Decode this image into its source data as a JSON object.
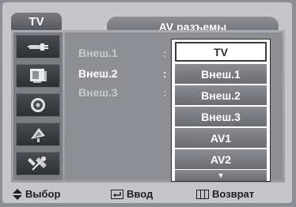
{
  "header": {
    "tab_label": "TV",
    "title": "AV разъемы"
  },
  "sidebar": {
    "icons": [
      "plug-icon",
      "picture-icon",
      "speaker-icon",
      "satellite-icon",
      "tools-icon"
    ]
  },
  "settings": [
    {
      "label": "Внеш.1",
      "separator": ":"
    },
    {
      "label": "Внеш.2",
      "separator": ":"
    },
    {
      "label": "Внеш.3",
      "separator": ":"
    }
  ],
  "dropdown": {
    "selected": "TV",
    "options": [
      "Внеш.1",
      "Внеш.2",
      "Внеш.3",
      "AV1",
      "AV2"
    ],
    "more_indicator": "▼"
  },
  "footer": {
    "move": "Выбор",
    "enter": "Ввод",
    "return": "Возврат"
  },
  "colors": {
    "panel": "#9a9ca1",
    "option": "#7a7c82",
    "selected_option": "#ffffff"
  }
}
